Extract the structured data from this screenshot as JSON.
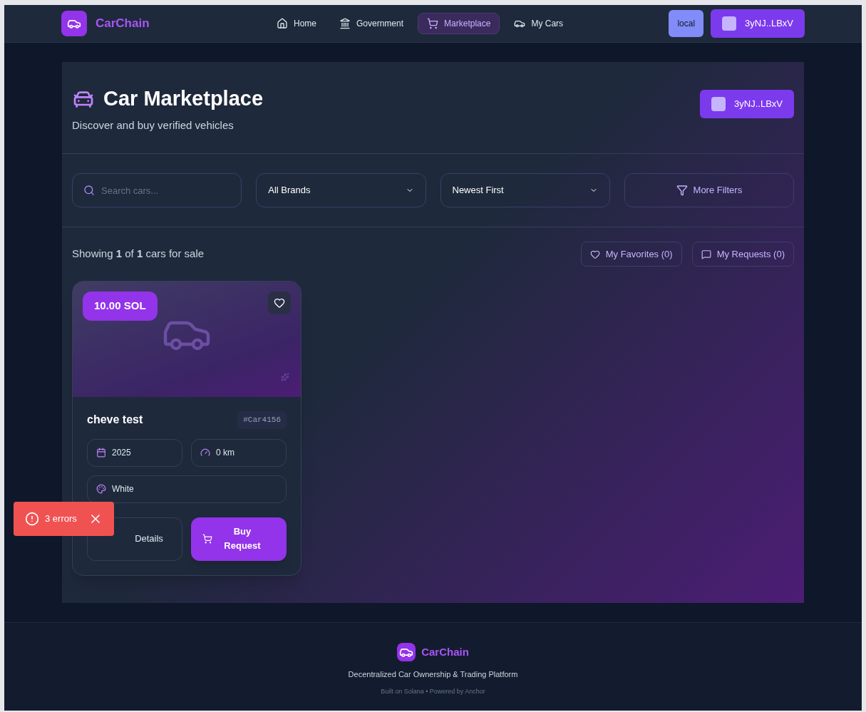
{
  "nav": {
    "brand": "CarChain",
    "links": [
      {
        "label": "Home",
        "selected": false
      },
      {
        "label": "Government",
        "selected": false
      },
      {
        "label": "Marketplace",
        "selected": true
      },
      {
        "label": "My Cars",
        "selected": false
      }
    ],
    "network": "local",
    "wallet": "3yNJ..LBxV"
  },
  "header": {
    "title": "Car Marketplace",
    "subtitle": "Discover and buy verified vehicles",
    "wallet": "3yNJ..LBxV"
  },
  "filters": {
    "search_placeholder": "Search cars...",
    "brand": "All Brands",
    "sort": "Newest First",
    "more": "More Filters"
  },
  "summary": {
    "text": "Showing **1** of **1** cars for sale",
    "favorites": "My Favorites (0)",
    "requests": "My Requests (0)"
  },
  "cars": [
    {
      "price": "10.00 SOL",
      "name": "cheve test",
      "id": "#Car4156",
      "year": "2025",
      "mileage": "0 km",
      "paint": "White",
      "details": "Details",
      "buy": "Buy Request",
      "favorite": false
    }
  ],
  "toast": {
    "text": "3 errors"
  },
  "footer": {
    "brand": "CarChain",
    "tagline": "Decentralized Car Ownership & Trading Platform",
    "credits": "Built on Solana • Powered by Anchor"
  }
}
